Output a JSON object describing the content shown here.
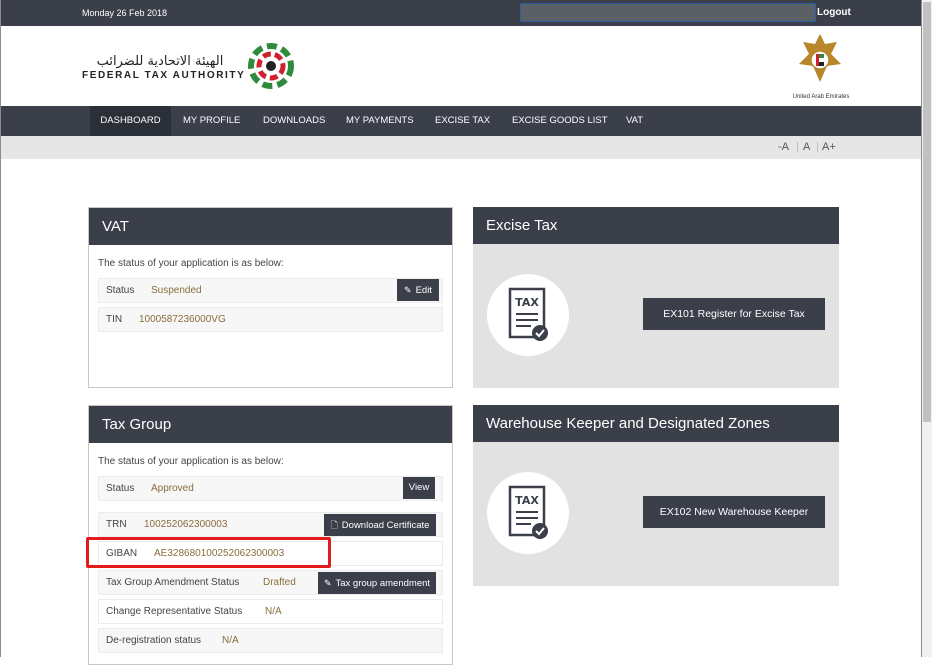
{
  "topbar": {
    "date": "Monday 26 Feb 2018",
    "logout": "Logout"
  },
  "header": {
    "logo_arabic": "الهيئة الاتحادية للضرائب",
    "logo_english": "FEDERAL TAX AUTHORITY",
    "emblem_label": "United Arab Emirates"
  },
  "nav": {
    "items": [
      "DASHBOARD",
      "MY PROFILE",
      "DOWNLOADS",
      "MY PAYMENTS",
      "EXCISE TAX",
      "EXCISE GOODS LIST",
      "VAT"
    ]
  },
  "font_controls": {
    "decrease": "-A",
    "normal": "A",
    "increase": "A+"
  },
  "vat_panel": {
    "title": "VAT",
    "intro": "The status of your application is as below:",
    "status_label": "Status",
    "status_value": "Suspended",
    "edit_button": "Edit",
    "tin_label": "TIN",
    "tin_value": "1000587236000VG"
  },
  "excise_panel": {
    "title": "Excise Tax",
    "icon_text": "TAX",
    "button": "EX101 Register for Excise Tax"
  },
  "taxgroup_panel": {
    "title": "Tax Group",
    "intro": "The status of your application is as below:",
    "status_label": "Status",
    "status_value": "Approved",
    "view_button": "View",
    "trn_label": "TRN",
    "trn_value": "100252062300003",
    "download_button": "Download Certificate",
    "giban_label": "GIBAN",
    "giban_value": "AE328680100252062300003",
    "amendment_label": "Tax Group Amendment Status",
    "amendment_value": "Drafted",
    "amendment_button": "Tax group amendment",
    "change_rep_label": "Change Representative Status",
    "change_rep_value": "N/A",
    "dereg_label": "De-registration status",
    "dereg_value": "N/A"
  },
  "warehouse_panel": {
    "title": "Warehouse Keeper and Designated Zones",
    "icon_text": "TAX",
    "button": "EX102 New Warehouse Keeper"
  },
  "colors": {
    "dark_bar": "#3a3f4a",
    "value_text": "#8a6d3b",
    "highlight": "#e31b1b"
  }
}
